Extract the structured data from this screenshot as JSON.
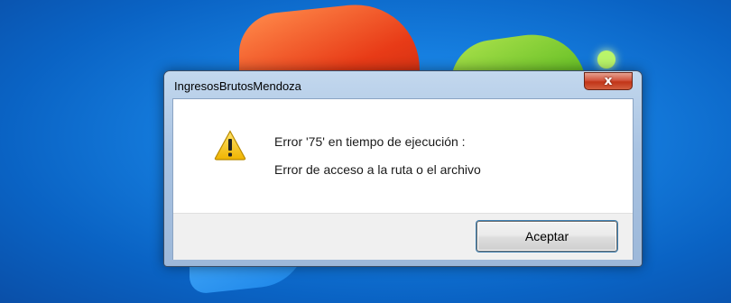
{
  "window": {
    "title": "IngresosBrutosMendoza",
    "close_glyph": "x"
  },
  "dialog": {
    "icon": "warning-icon",
    "message_line1": "Error '75' en tiempo de ejecución :",
    "message_line2": "Error de acceso a la ruta o el archivo",
    "ok_label": "Aceptar"
  },
  "colors": {
    "desktop_blue": "#1677db",
    "close_red": "#c23518",
    "warning_yellow": "#f5c518"
  }
}
